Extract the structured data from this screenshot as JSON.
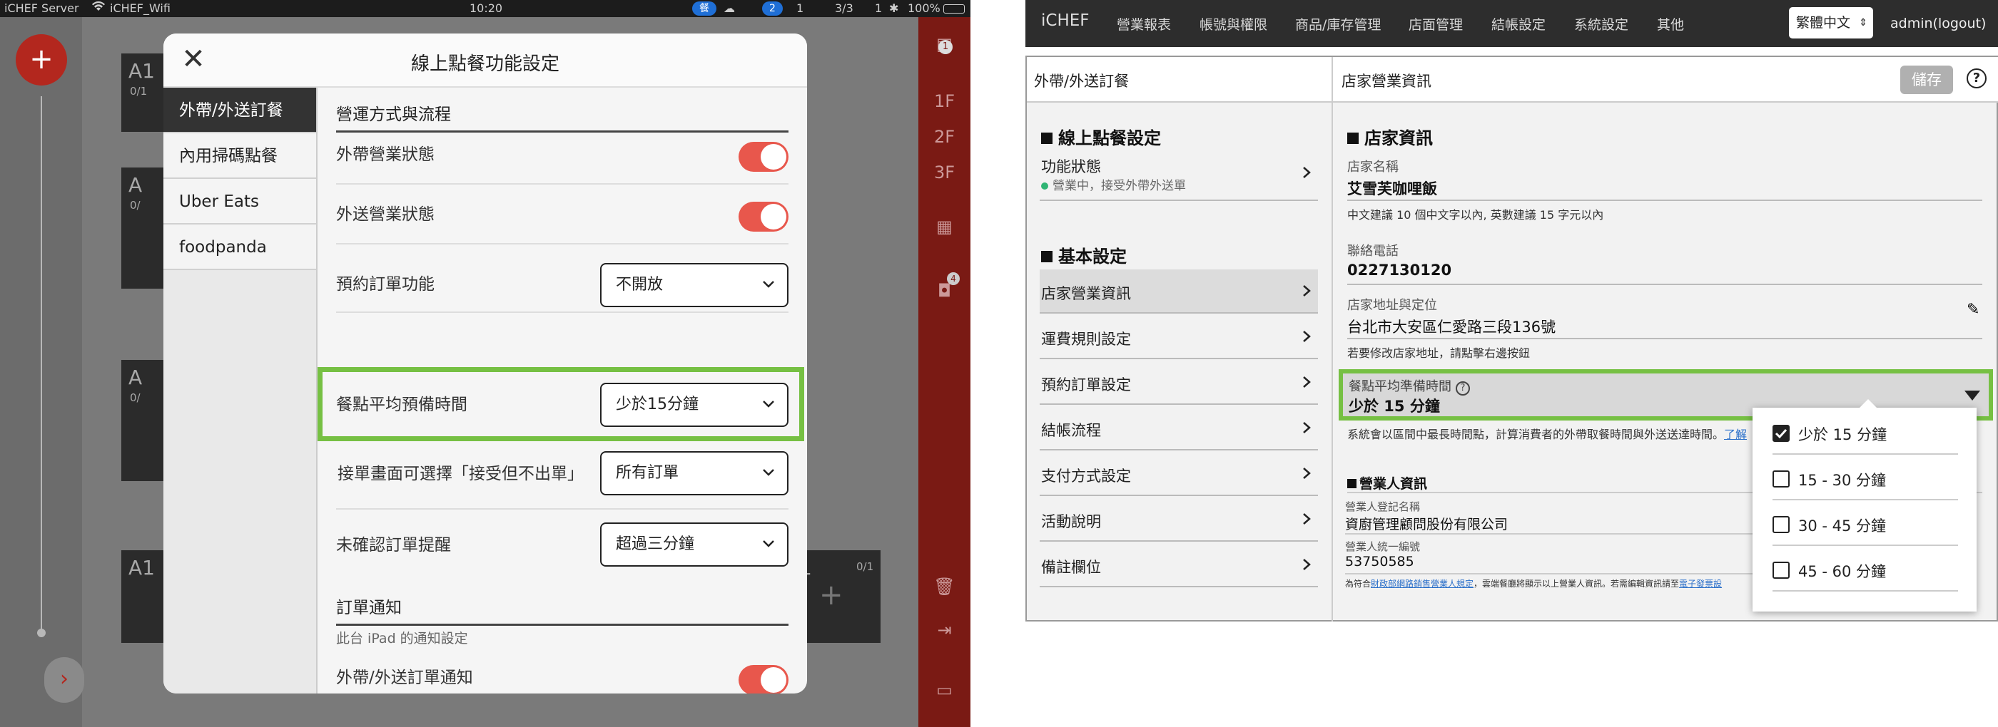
{
  "ipad": {
    "status_bar": {
      "carrier": "iCHEF Server",
      "wifi": "iCHEF_Wifi",
      "time": "10:20",
      "badge1": "餐",
      "badge2": "2",
      "c1": "1",
      "c2": "3/3",
      "c3": "1",
      "battery": "100%"
    },
    "bg_tiles": [
      {
        "t": "A1",
        "s": "0/1"
      },
      {
        "t": "A",
        "s": "0/"
      },
      {
        "t": "A",
        "s": "0/"
      },
      {
        "t": "A1",
        "s": ""
      },
      {
        "t": "1",
        "s": "0/1"
      }
    ],
    "floors": [
      "1F",
      "2F",
      "3F"
    ],
    "rail_badge": "1",
    "rail_badge2": "4",
    "modal": {
      "title": "線上點餐功能設定",
      "tabs": [
        "外帶/外送訂餐",
        "內用掃碼點餐",
        "Uber Eats",
        "foodpanda"
      ],
      "section1": "營運方式與流程",
      "rows": {
        "takeout_status": "外帶營業狀態",
        "delivery_status": "外送營業狀態",
        "reservation": {
          "label": "預約訂單功能",
          "value": "不開放"
        },
        "prep_time": {
          "label": "餐點平均預備時間",
          "value": "少於15分鐘"
        },
        "accept_no_print": {
          "label": "接單畫面可選擇「接受但不出單」",
          "value": "所有訂單"
        },
        "unconfirmed_alert": {
          "label": "未確認訂單提醒",
          "value": "超過三分鐘"
        }
      },
      "section2": "訂單通知",
      "section2_note": "此台 iPad 的通知設定",
      "notify_row": "外帶/外送訂單通知"
    }
  },
  "web": {
    "logo": "iCHEF",
    "menu": [
      "營業報表",
      "帳號與權限",
      "商品/庫存管理",
      "店面管理",
      "結帳設定",
      "系統設定",
      "其他"
    ],
    "language": "繁體中文",
    "admin": "admin(logout)",
    "panel_left_title": "外帶/外送訂餐",
    "panel_right_title": "店家營業資訊",
    "save": "儲存",
    "left_nav": {
      "group1": "線上點餐設定",
      "func_status": "功能狀態",
      "func_status_sub": "營業中，接受外帶外送單",
      "group2": "基本設定",
      "items": [
        "店家營業資訊",
        "運費規則設定",
        "預約訂單設定",
        "結帳流程",
        "支付方式設定",
        "活動說明",
        "備註欄位"
      ]
    },
    "store": {
      "group": "店家資訊",
      "name_label": "店家名稱",
      "name_value": "艾雪芙咖哩飯",
      "name_hint": "中文建議 10 個中文字以內, 英數建議 15 字元以內",
      "phone_label": "聯絡電話",
      "phone_value": "0227130120",
      "addr_label": "店家地址與定位",
      "addr_value": "台北市大安區仁愛路三段136號",
      "addr_hint": "若要修改店家地址，請點擊右邊按鈕",
      "prep_label": "餐點平均準備時間",
      "prep_value": "少於 15 分鐘",
      "prep_hint": "系統會以區間中最長時間點，計算消費者的外帶取餐時間與外送送達時間。",
      "prep_link": "了解"
    },
    "business": {
      "group": "營業人資訊",
      "reg_label": "營業人登記名稱",
      "reg_value": "資廚管理顧問股份有限公司",
      "id_label": "營業人統一編號",
      "id_value": "53750585",
      "footer_a": "為符合",
      "footer_link1": "財政部網路銷售營業人規定",
      "footer_b": "，雲端餐廳將顯示以上營業人資訊。若需編輯資訊請至",
      "footer_link2": "電子發票設"
    },
    "dropdown": [
      "少於 15 分鐘",
      "15 - 30 分鐘",
      "30 - 45 分鐘",
      "45 - 60 分鐘"
    ]
  }
}
